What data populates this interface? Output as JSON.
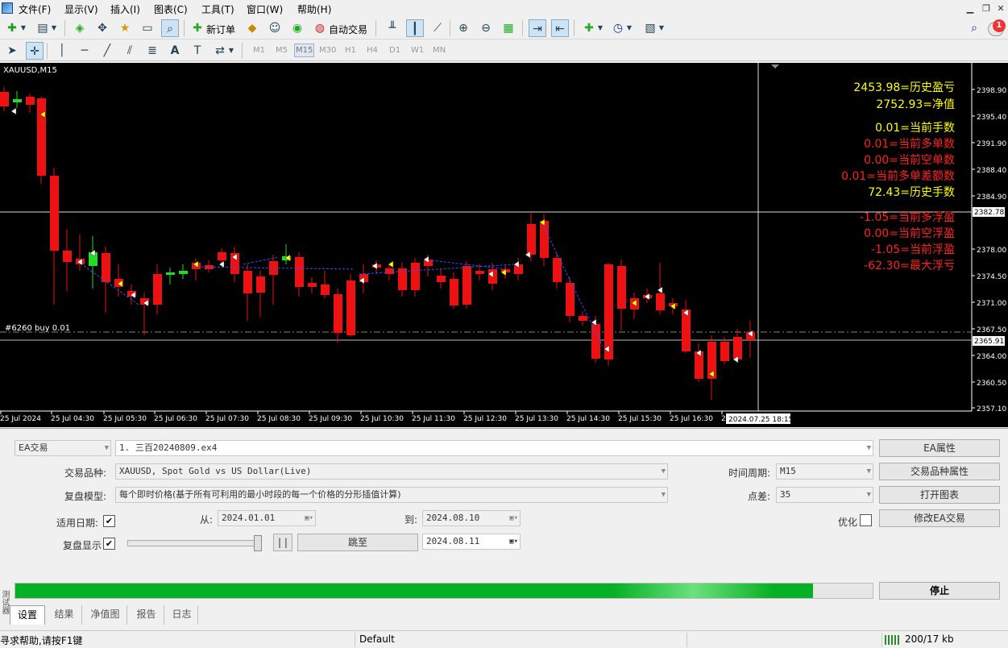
{
  "menu": {
    "items": [
      "文件(F)",
      "显示(V)",
      "插入(I)",
      "图表(C)",
      "工具(T)",
      "窗口(W)",
      "帮助(H)"
    ]
  },
  "toolbar": {
    "new_order": "新订单",
    "auto_trade": "自动交易",
    "notification_count": "1",
    "timeframes": [
      "M1",
      "M5",
      "M15",
      "M30",
      "H1",
      "H4",
      "D1",
      "W1",
      "MN"
    ],
    "active_timeframe": "M15"
  },
  "chart": {
    "symbol_label": "XAUUSD,M15",
    "order_label": "#6260 buy 0.01",
    "current_price": "2365.91",
    "crosshair_price": "2382.78",
    "crosshair_time": "2024.07.25 18:15",
    "price_ticks": [
      "2398.90",
      "2395.40",
      "2391.90",
      "2388.40",
      "2384.90",
      "2378.00",
      "2374.50",
      "2371.00",
      "2367.50",
      "2364.00",
      "2360.50",
      "2357.10"
    ],
    "time_ticks": [
      "25 Jul 2024",
      "25 Jul 04:30",
      "25 Jul 05:30",
      "25 Jul 06:30",
      "25 Jul 07:30",
      "25 Jul 08:30",
      "25 Jul 09:30",
      "25 Jul 10:30",
      "25 Jul 11:30",
      "25 Jul 12:30",
      "25 Jul 13:30",
      "25 Jul 14:30",
      "25 Jul 15:30",
      "25 Jul 16:30",
      "2"
    ],
    "colors": {
      "bull": "#22dd22",
      "bear": "#ee1111",
      "background": "#000000",
      "yellow": "#ffff00",
      "red": "#ff2020"
    },
    "stats": [
      {
        "text": "2453.98=历史盈亏",
        "color": "yellow"
      },
      {
        "text": "2752.93=净值",
        "color": "yellow"
      },
      {
        "text": "0.01=当前手数",
        "color": "yellow"
      },
      {
        "text": "0.01=当前多单数",
        "color": "red"
      },
      {
        "text": "0.00=当前空单数",
        "color": "red"
      },
      {
        "text": "0.01=当前多单差额数",
        "color": "red"
      },
      {
        "text": "72.43=历史手数",
        "color": "yellow"
      },
      {
        "text": "-1.05=当前多浮盈",
        "color": "red"
      },
      {
        "text": "0.00=当前空浮盈",
        "color": "red"
      },
      {
        "text": "-1.05=当前浮盈",
        "color": "red"
      },
      {
        "text": "-62.30=最大浮亏",
        "color": "red"
      }
    ]
  },
  "tester": {
    "mode_select": "EA交易",
    "ea_file": "1. 三百20240809.ex4",
    "symbol_label": "交易品种:",
    "symbol_value": "XAUUSD, Spot Gold vs US Dollar(Live)",
    "model_label": "复盘模型:",
    "model_value": "每个即时价格(基于所有可利用的最小时段的每一个价格的分形插值计算)",
    "use_date_label": "适用日期:",
    "from_label": "从:",
    "from_value": "2024.01.01",
    "to_label": "到:",
    "to_value": "2024.08.10",
    "visual_label": "复盘显示",
    "pause_label": "| |",
    "skip_label": "跳至",
    "skip_date": "2024.08.11",
    "period_label": "时间周期:",
    "period_value": "M15",
    "spread_label": "点差:",
    "spread_value": "35",
    "optimize_label": "优化",
    "progress": 0.93,
    "buttons": {
      "ea_props": "EA属性",
      "symbol_props": "交易品种属性",
      "open_chart": "打开图表",
      "modify_ea": "修改EA交易",
      "stop": "停止"
    },
    "tabs": [
      "设置",
      "结果",
      "净值图",
      "报告",
      "日志"
    ],
    "active_tab": "设置",
    "side_label": "测试器"
  },
  "status": {
    "help": "寻求帮助,请按F1键",
    "profile": "Default",
    "traffic": "200/17 kb"
  }
}
